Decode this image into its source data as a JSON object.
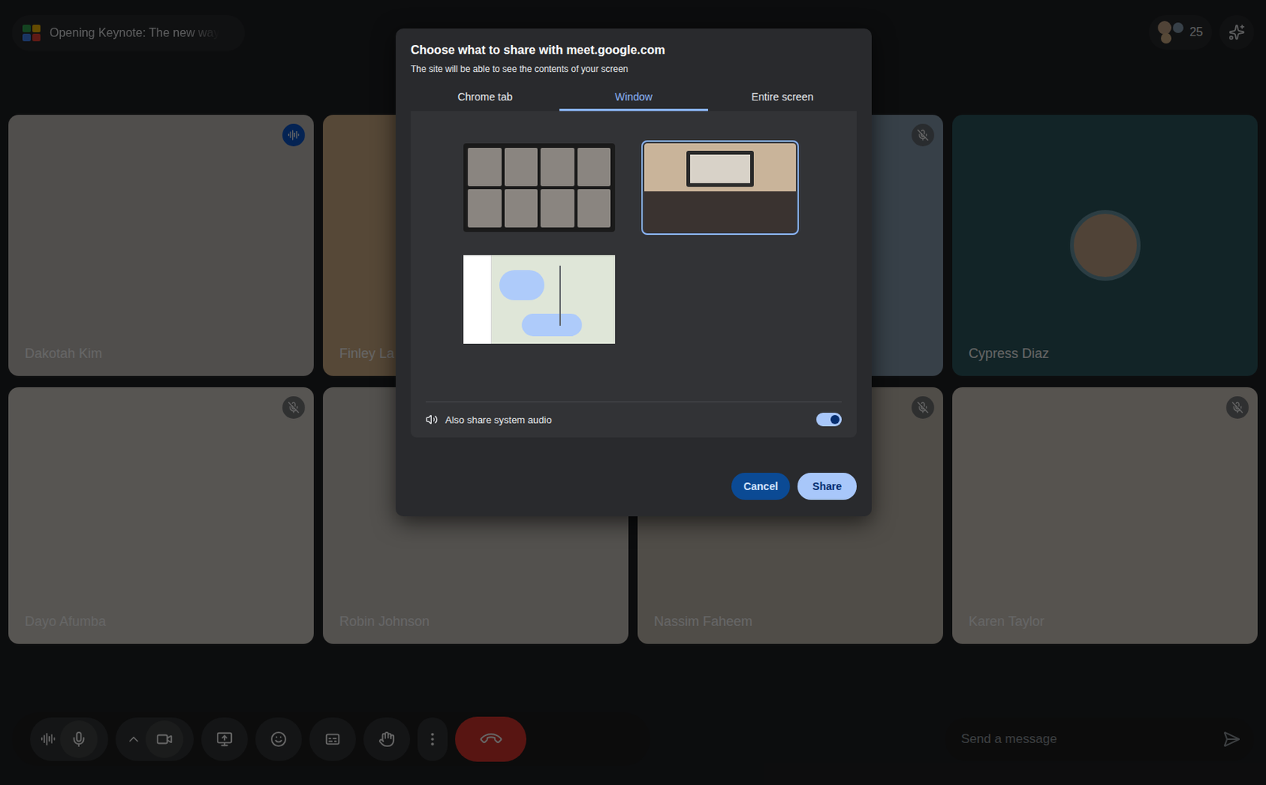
{
  "meeting": {
    "title": "Opening Keynote: The new way",
    "participants": "25"
  },
  "tiles": [
    {
      "name": "Dakotah Kim",
      "kind": "video",
      "speaking": true,
      "muted": false,
      "color": "#c9c4bf"
    },
    {
      "name": "Finley La",
      "kind": "video",
      "speaking": false,
      "muted": false,
      "color": "#d8b48a"
    },
    {
      "kind": "video",
      "speaking": false,
      "muted": true,
      "color": "#8aa0b4"
    },
    {
      "name": "Cypress Diaz",
      "kind": "avatar",
      "speaking": false,
      "muted": false,
      "color": "#2f5b63"
    },
    {
      "name": "Dayo Afumba",
      "kind": "video",
      "speaking": false,
      "muted": true,
      "color": "#d9d4cc"
    },
    {
      "name": "Robin Johnson",
      "kind": "video",
      "speaking": false,
      "muted": false,
      "color": "#cfcac4"
    },
    {
      "name": "Nassim Faheem",
      "kind": "video",
      "speaking": false,
      "muted": true,
      "color": "#c8c0b4"
    },
    {
      "name": "Karen Taylor",
      "kind": "video",
      "speaking": false,
      "muted": true,
      "color": "#d8cfc6"
    }
  ],
  "chat": {
    "placeholder": "Send a message"
  },
  "dialog": {
    "title": "Choose what to share with meet.google.com",
    "subtitle": "The site will be able to see the contents of your screen",
    "tabs": [
      {
        "label": "Chrome tab",
        "selected": false
      },
      {
        "label": "Window",
        "selected": true
      },
      {
        "label": "Entire screen",
        "selected": false
      }
    ],
    "windows": [
      {
        "kind": "meet",
        "selected": false
      },
      {
        "kind": "video",
        "selected": true
      },
      {
        "kind": "map",
        "selected": false
      }
    ],
    "audio": {
      "label": "Also share system audio",
      "on": true
    },
    "buttons": {
      "cancel": "Cancel",
      "share": "Share"
    }
  }
}
